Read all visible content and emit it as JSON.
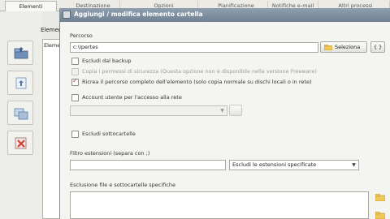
{
  "tabs": [
    {
      "label": "Elementi",
      "active": true
    },
    {
      "label": "Destinazione",
      "active": false
    },
    {
      "label": "Opzioni",
      "active": false
    },
    {
      "label": "Pianificazione",
      "active": false
    },
    {
      "label": "Notifiche e-mail",
      "active": false
    },
    {
      "label": "Altri processi",
      "active": false
    }
  ],
  "main": {
    "section_label": "Element",
    "list_first_row": "Elemen"
  },
  "side_buttons": [
    {
      "icon": "add-folder-icon"
    },
    {
      "icon": "add-file-icon"
    },
    {
      "icon": "edit-element-icon"
    },
    {
      "icon": "delete-element-icon"
    }
  ],
  "dialog": {
    "title": "Aggiungi / modifica elemento cartella",
    "path_label": "Percorso",
    "path_value": "c:\\Ipertes",
    "browse_button": "Seleziona",
    "extra_button": "{ }",
    "exclude_backup": "Escludi dal backup",
    "copy_permissions": "Copia i permessi di sicurezza (Questa opzione non è disponibile nella versione Freeware)",
    "full_path": "Ricrea il percorso completo dell'elemento (solo copia normale su dischi locali o in rete)",
    "network_account": "Account utente per l'accesso alla rete",
    "exclude_subfolders": "Escludi sottocartelle",
    "filter_label": "Filtro estensioni (separa con ;)",
    "filter_value": "",
    "filter_mode": "Escludi le estensioni specificate",
    "exclusion_label": "Esclusione file e sottocartelle specifiche",
    "checks": {
      "exclude_backup": false,
      "copy_permissions": false,
      "full_path": true,
      "network_account": false,
      "exclude_subfolders": false
    }
  }
}
